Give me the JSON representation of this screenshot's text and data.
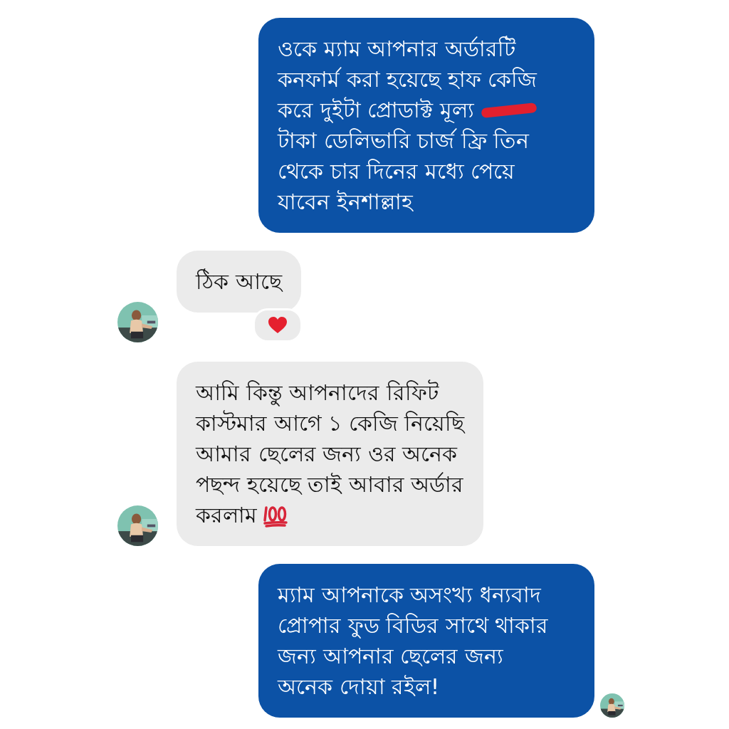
{
  "messages": [
    {
      "kind": "outgoing",
      "seen": false,
      "rows": [
        [
          {
            "kind": "text",
            "text": "ওকে ম্যাম আপনার অর্ডারটি\nকনফার্ম করা হয়েছে হাফ কেজি"
          }
        ],
        [
          {
            "kind": "text",
            "text": "করে দুইটা প্রোডাক্ট মূল্য"
          },
          {
            "kind": "redaction"
          }
        ],
        [
          {
            "kind": "text",
            "text": "টাকা ডেলিভারি চার্জ ফ্রি তিন\nথেকে চার দিনের মধ্যে পেয়ে\nযাবেন ইনশাল্লাহ"
          }
        ]
      ]
    },
    {
      "kind": "incoming",
      "reactions": [
        {
          "kind": "heart"
        }
      ],
      "rows": [
        [
          {
            "kind": "text",
            "text": "ঠিক আছে"
          }
        ]
      ]
    },
    {
      "kind": "incoming",
      "rows": [
        [
          {
            "kind": "text",
            "text": "আমি কিন্তু  আপনাদের  রিফিট\nকাস্টমার  আগে  ১ কেজি নিয়েছি\nআমার  ছেলের  জন্য  ওর অনেক\nপছন্দ  হয়েছে  তাই  আবার  অর্ডার"
          }
        ],
        [
          {
            "kind": "text",
            "text": "করলাম"
          },
          {
            "kind": "hundred"
          }
        ]
      ]
    },
    {
      "kind": "outgoing",
      "seen": true,
      "rows": [
        [
          {
            "kind": "text",
            "text": "ম্যাম আপনাকে অসংখ্য ধন্যবাদ\nপ্রোপার ফুড বিডির সাথে থাকার\nজন্য আপনার ছেলের জন্য\nঅনেক দোয়া রইল!"
          }
        ]
      ]
    }
  ]
}
